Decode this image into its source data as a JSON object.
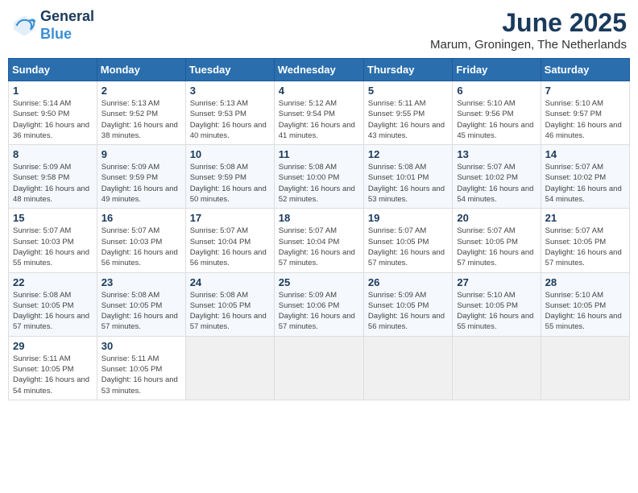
{
  "logo": {
    "line1": "General",
    "line2": "Blue"
  },
  "title": "June 2025",
  "location": "Marum, Groningen, The Netherlands",
  "weekdays": [
    "Sunday",
    "Monday",
    "Tuesday",
    "Wednesday",
    "Thursday",
    "Friday",
    "Saturday"
  ],
  "weeks": [
    [
      {
        "day": "1",
        "sunrise": "Sunrise: 5:14 AM",
        "sunset": "Sunset: 9:50 PM",
        "daylight": "Daylight: 16 hours and 36 minutes."
      },
      {
        "day": "2",
        "sunrise": "Sunrise: 5:13 AM",
        "sunset": "Sunset: 9:52 PM",
        "daylight": "Daylight: 16 hours and 38 minutes."
      },
      {
        "day": "3",
        "sunrise": "Sunrise: 5:13 AM",
        "sunset": "Sunset: 9:53 PM",
        "daylight": "Daylight: 16 hours and 40 minutes."
      },
      {
        "day": "4",
        "sunrise": "Sunrise: 5:12 AM",
        "sunset": "Sunset: 9:54 PM",
        "daylight": "Daylight: 16 hours and 41 minutes."
      },
      {
        "day": "5",
        "sunrise": "Sunrise: 5:11 AM",
        "sunset": "Sunset: 9:55 PM",
        "daylight": "Daylight: 16 hours and 43 minutes."
      },
      {
        "day": "6",
        "sunrise": "Sunrise: 5:10 AM",
        "sunset": "Sunset: 9:56 PM",
        "daylight": "Daylight: 16 hours and 45 minutes."
      },
      {
        "day": "7",
        "sunrise": "Sunrise: 5:10 AM",
        "sunset": "Sunset: 9:57 PM",
        "daylight": "Daylight: 16 hours and 46 minutes."
      }
    ],
    [
      {
        "day": "8",
        "sunrise": "Sunrise: 5:09 AM",
        "sunset": "Sunset: 9:58 PM",
        "daylight": "Daylight: 16 hours and 48 minutes."
      },
      {
        "day": "9",
        "sunrise": "Sunrise: 5:09 AM",
        "sunset": "Sunset: 9:59 PM",
        "daylight": "Daylight: 16 hours and 49 minutes."
      },
      {
        "day": "10",
        "sunrise": "Sunrise: 5:08 AM",
        "sunset": "Sunset: 9:59 PM",
        "daylight": "Daylight: 16 hours and 50 minutes."
      },
      {
        "day": "11",
        "sunrise": "Sunrise: 5:08 AM",
        "sunset": "Sunset: 10:00 PM",
        "daylight": "Daylight: 16 hours and 52 minutes."
      },
      {
        "day": "12",
        "sunrise": "Sunrise: 5:08 AM",
        "sunset": "Sunset: 10:01 PM",
        "daylight": "Daylight: 16 hours and 53 minutes."
      },
      {
        "day": "13",
        "sunrise": "Sunrise: 5:07 AM",
        "sunset": "Sunset: 10:02 PM",
        "daylight": "Daylight: 16 hours and 54 minutes."
      },
      {
        "day": "14",
        "sunrise": "Sunrise: 5:07 AM",
        "sunset": "Sunset: 10:02 PM",
        "daylight": "Daylight: 16 hours and 54 minutes."
      }
    ],
    [
      {
        "day": "15",
        "sunrise": "Sunrise: 5:07 AM",
        "sunset": "Sunset: 10:03 PM",
        "daylight": "Daylight: 16 hours and 55 minutes."
      },
      {
        "day": "16",
        "sunrise": "Sunrise: 5:07 AM",
        "sunset": "Sunset: 10:03 PM",
        "daylight": "Daylight: 16 hours and 56 minutes."
      },
      {
        "day": "17",
        "sunrise": "Sunrise: 5:07 AM",
        "sunset": "Sunset: 10:04 PM",
        "daylight": "Daylight: 16 hours and 56 minutes."
      },
      {
        "day": "18",
        "sunrise": "Sunrise: 5:07 AM",
        "sunset": "Sunset: 10:04 PM",
        "daylight": "Daylight: 16 hours and 57 minutes."
      },
      {
        "day": "19",
        "sunrise": "Sunrise: 5:07 AM",
        "sunset": "Sunset: 10:05 PM",
        "daylight": "Daylight: 16 hours and 57 minutes."
      },
      {
        "day": "20",
        "sunrise": "Sunrise: 5:07 AM",
        "sunset": "Sunset: 10:05 PM",
        "daylight": "Daylight: 16 hours and 57 minutes."
      },
      {
        "day": "21",
        "sunrise": "Sunrise: 5:07 AM",
        "sunset": "Sunset: 10:05 PM",
        "daylight": "Daylight: 16 hours and 57 minutes."
      }
    ],
    [
      {
        "day": "22",
        "sunrise": "Sunrise: 5:08 AM",
        "sunset": "Sunset: 10:05 PM",
        "daylight": "Daylight: 16 hours and 57 minutes."
      },
      {
        "day": "23",
        "sunrise": "Sunrise: 5:08 AM",
        "sunset": "Sunset: 10:05 PM",
        "daylight": "Daylight: 16 hours and 57 minutes."
      },
      {
        "day": "24",
        "sunrise": "Sunrise: 5:08 AM",
        "sunset": "Sunset: 10:05 PM",
        "daylight": "Daylight: 16 hours and 57 minutes."
      },
      {
        "day": "25",
        "sunrise": "Sunrise: 5:09 AM",
        "sunset": "Sunset: 10:06 PM",
        "daylight": "Daylight: 16 hours and 57 minutes."
      },
      {
        "day": "26",
        "sunrise": "Sunrise: 5:09 AM",
        "sunset": "Sunset: 10:05 PM",
        "daylight": "Daylight: 16 hours and 56 minutes."
      },
      {
        "day": "27",
        "sunrise": "Sunrise: 5:10 AM",
        "sunset": "Sunset: 10:05 PM",
        "daylight": "Daylight: 16 hours and 55 minutes."
      },
      {
        "day": "28",
        "sunrise": "Sunrise: 5:10 AM",
        "sunset": "Sunset: 10:05 PM",
        "daylight": "Daylight: 16 hours and 55 minutes."
      }
    ],
    [
      {
        "day": "29",
        "sunrise": "Sunrise: 5:11 AM",
        "sunset": "Sunset: 10:05 PM",
        "daylight": "Daylight: 16 hours and 54 minutes."
      },
      {
        "day": "30",
        "sunrise": "Sunrise: 5:11 AM",
        "sunset": "Sunset: 10:05 PM",
        "daylight": "Daylight: 16 hours and 53 minutes."
      },
      null,
      null,
      null,
      null,
      null
    ]
  ]
}
